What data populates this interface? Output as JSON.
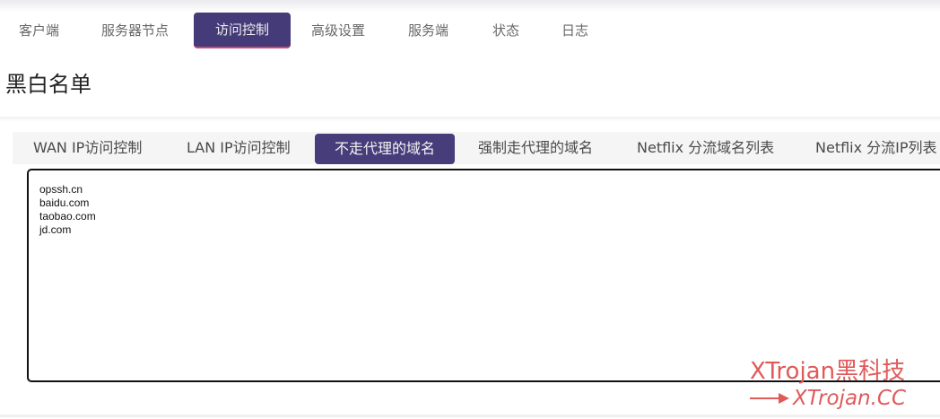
{
  "top_tabs": [
    "客户端",
    "服务器节点",
    "访问控制",
    "高级设置",
    "服务端",
    "状态",
    "日志"
  ],
  "active_top_tab": "访问控制",
  "page_title": "黑白名单",
  "sub_tabs": [
    "WAN IP访问控制",
    "LAN IP访问控制",
    "不走代理的域名",
    "强制走代理的域名",
    "Netflix 分流域名列表",
    "Netflix 分流IP列表"
  ],
  "active_sub_tab": "不走代理的域名",
  "editor_value": "opssh.cn\nbaidu.com\ntaobao.com\njd.com",
  "watermark": {
    "brand": "XTrojan黑科技",
    "url": "XTrojan.CC"
  },
  "colors": {
    "accent": "#443b78",
    "active_underline": "#c84d6e",
    "watermark": "#e05a5a"
  }
}
